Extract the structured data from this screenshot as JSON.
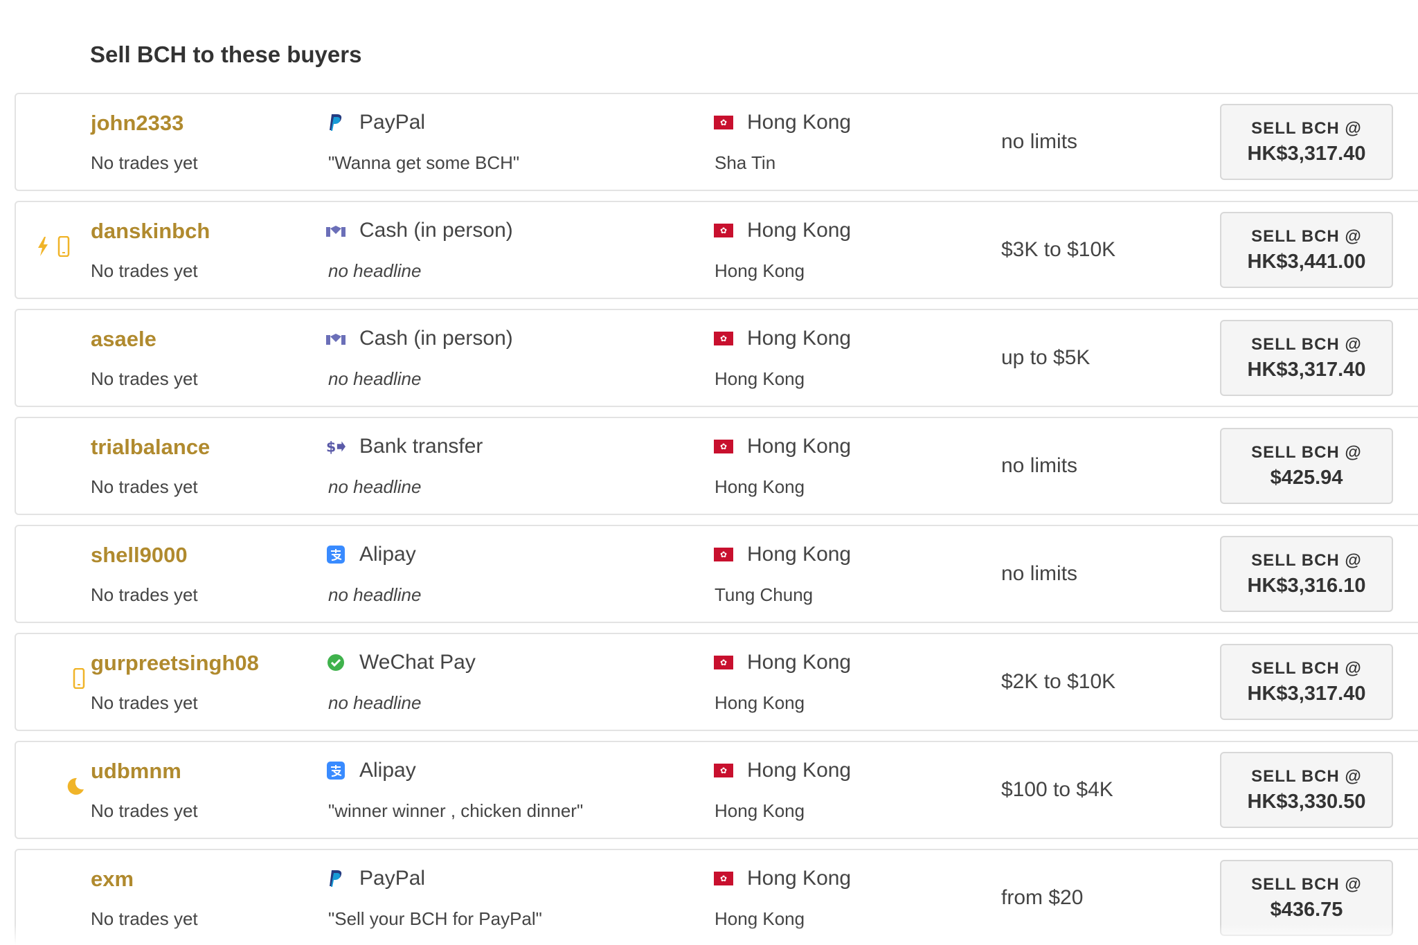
{
  "section_title": "Sell BCH to these buyers",
  "colors": {
    "username": "#b08a2e",
    "badge": "#f0b429",
    "flag": "#c8102e"
  },
  "rows": [
    {
      "username": "john2333",
      "badges": [],
      "trades": "No trades yet",
      "method": "PayPal",
      "method_icon": "paypal-icon",
      "headline": "\"Wanna get some BCH\"",
      "country": "Hong Kong",
      "city": "Sha Tin",
      "limits": "no limits",
      "sell_label": "SELL BCH @",
      "price": "HK$3,317.40"
    },
    {
      "username": "danskinbch",
      "badges": [
        "lightning-icon",
        "mobile-icon"
      ],
      "trades": "No trades yet",
      "method": "Cash (in person)",
      "method_icon": "handshake-icon",
      "headline": "no headline",
      "country": "Hong Kong",
      "city": "Hong Kong",
      "limits": "$3K to $10K",
      "sell_label": "SELL BCH @",
      "price": "HK$3,441.00"
    },
    {
      "username": "asaele",
      "badges": [],
      "trades": "No trades yet",
      "method": "Cash (in person)",
      "method_icon": "handshake-icon",
      "headline": "no headline",
      "country": "Hong Kong",
      "city": "Hong Kong",
      "limits": "up to $5K",
      "sell_label": "SELL BCH @",
      "price": "HK$3,317.40"
    },
    {
      "username": "trialbalance",
      "badges": [],
      "trades": "No trades yet",
      "method": "Bank transfer",
      "method_icon": "bank-transfer-icon",
      "headline": "no headline",
      "country": "Hong Kong",
      "city": "Hong Kong",
      "limits": "no limits",
      "sell_label": "SELL BCH @",
      "price": "$425.94"
    },
    {
      "username": "shell9000",
      "badges": [],
      "trades": "No trades yet",
      "method": "Alipay",
      "method_icon": "alipay-icon",
      "headline": "no headline",
      "country": "Hong Kong",
      "city": "Tung Chung",
      "limits": "no limits",
      "sell_label": "SELL BCH @",
      "price": "HK$3,316.10"
    },
    {
      "username": "gurpreetsingh08",
      "badges": [
        "mobile-icon"
      ],
      "trades": "No trades yet",
      "method": "WeChat Pay",
      "method_icon": "wechat-icon",
      "headline": "no headline",
      "country": "Hong Kong",
      "city": "Hong Kong",
      "limits": "$2K to $10K",
      "sell_label": "SELL BCH @",
      "price": "HK$3,317.40"
    },
    {
      "username": "udbmnm",
      "badges": [
        "moon-icon"
      ],
      "trades": "No trades yet",
      "method": "Alipay",
      "method_icon": "alipay-icon",
      "headline": "\"winner winner , chicken dinner\"",
      "country": "Hong Kong",
      "city": "Hong Kong",
      "limits": "$100 to $4K",
      "sell_label": "SELL BCH @",
      "price": "HK$3,330.50"
    },
    {
      "username": "exm",
      "badges": [],
      "trades": "No trades yet",
      "method": "PayPal",
      "method_icon": "paypal-icon",
      "headline": "\"Sell your BCH for PayPal\"",
      "country": "Hong Kong",
      "city": "Hong Kong",
      "limits": "from $20",
      "sell_label": "SELL BCH @",
      "price": "$436.75"
    }
  ]
}
